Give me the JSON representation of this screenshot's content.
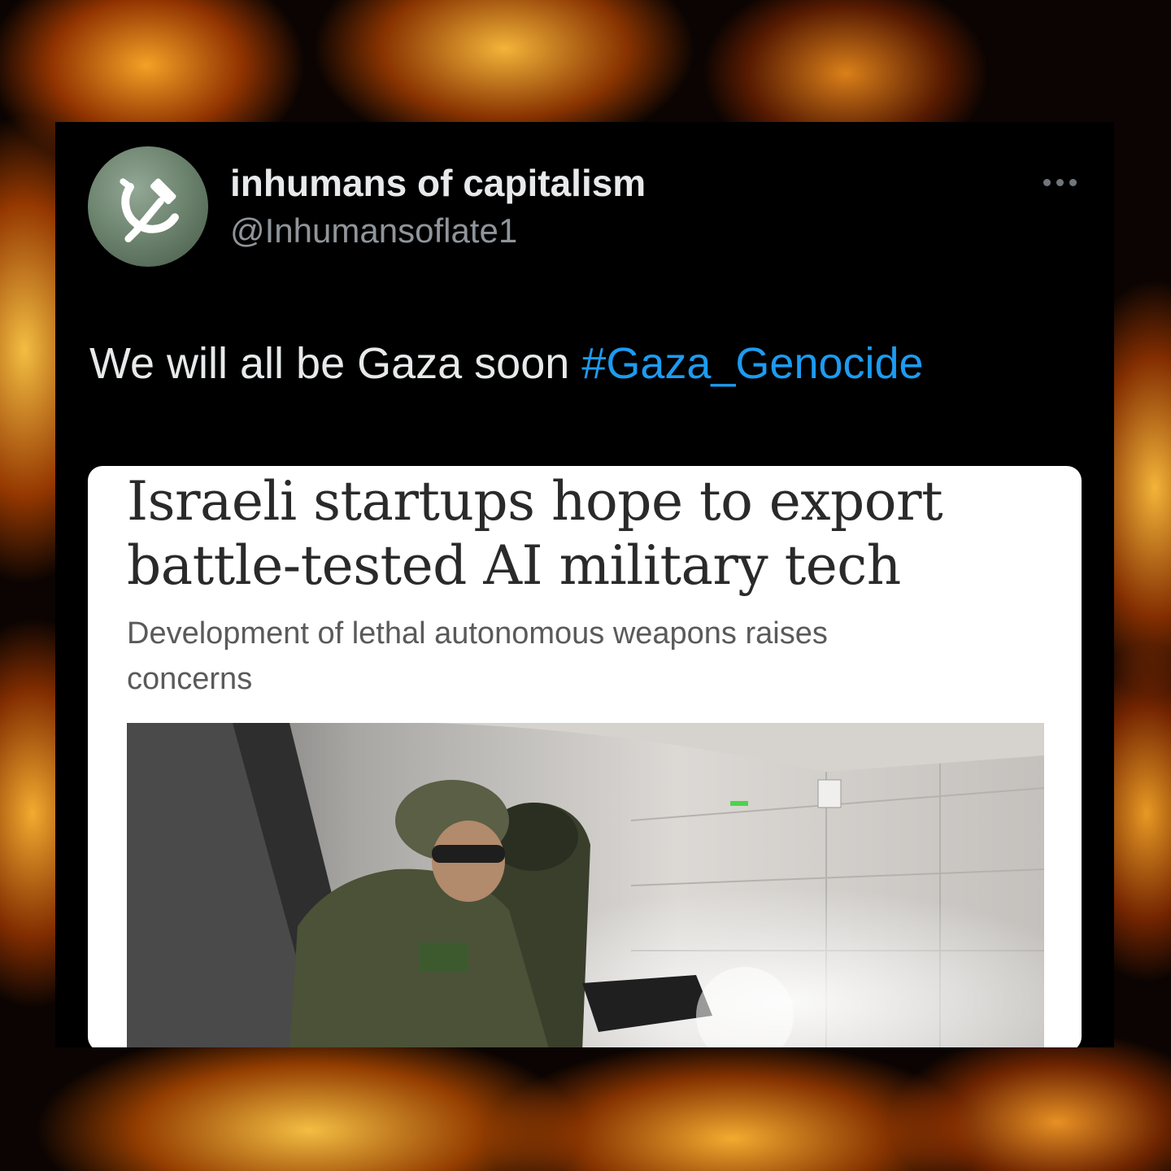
{
  "tweet": {
    "author": {
      "display_name": "inhumans of capitalism",
      "handle": "@Inhumansoflate1",
      "avatar_icon": "hammer-sickle-icon"
    },
    "more_icon": "more-horizontal-icon",
    "text": "We will all be Gaza soon ",
    "hashtag": "#Gaza_Genocide",
    "link_color": "#1d9bf0"
  },
  "article": {
    "headline_line1": "Israeli startups hope to export",
    "headline_line2": "battle-tested AI military tech",
    "subheadline_line1": "Development of lethal autonomous weapons raises",
    "subheadline_line2": "concerns"
  },
  "colors": {
    "background": "#0b0402",
    "card": "#000000",
    "name_text": "#e7e9ea",
    "handle_text": "#8f959a"
  }
}
